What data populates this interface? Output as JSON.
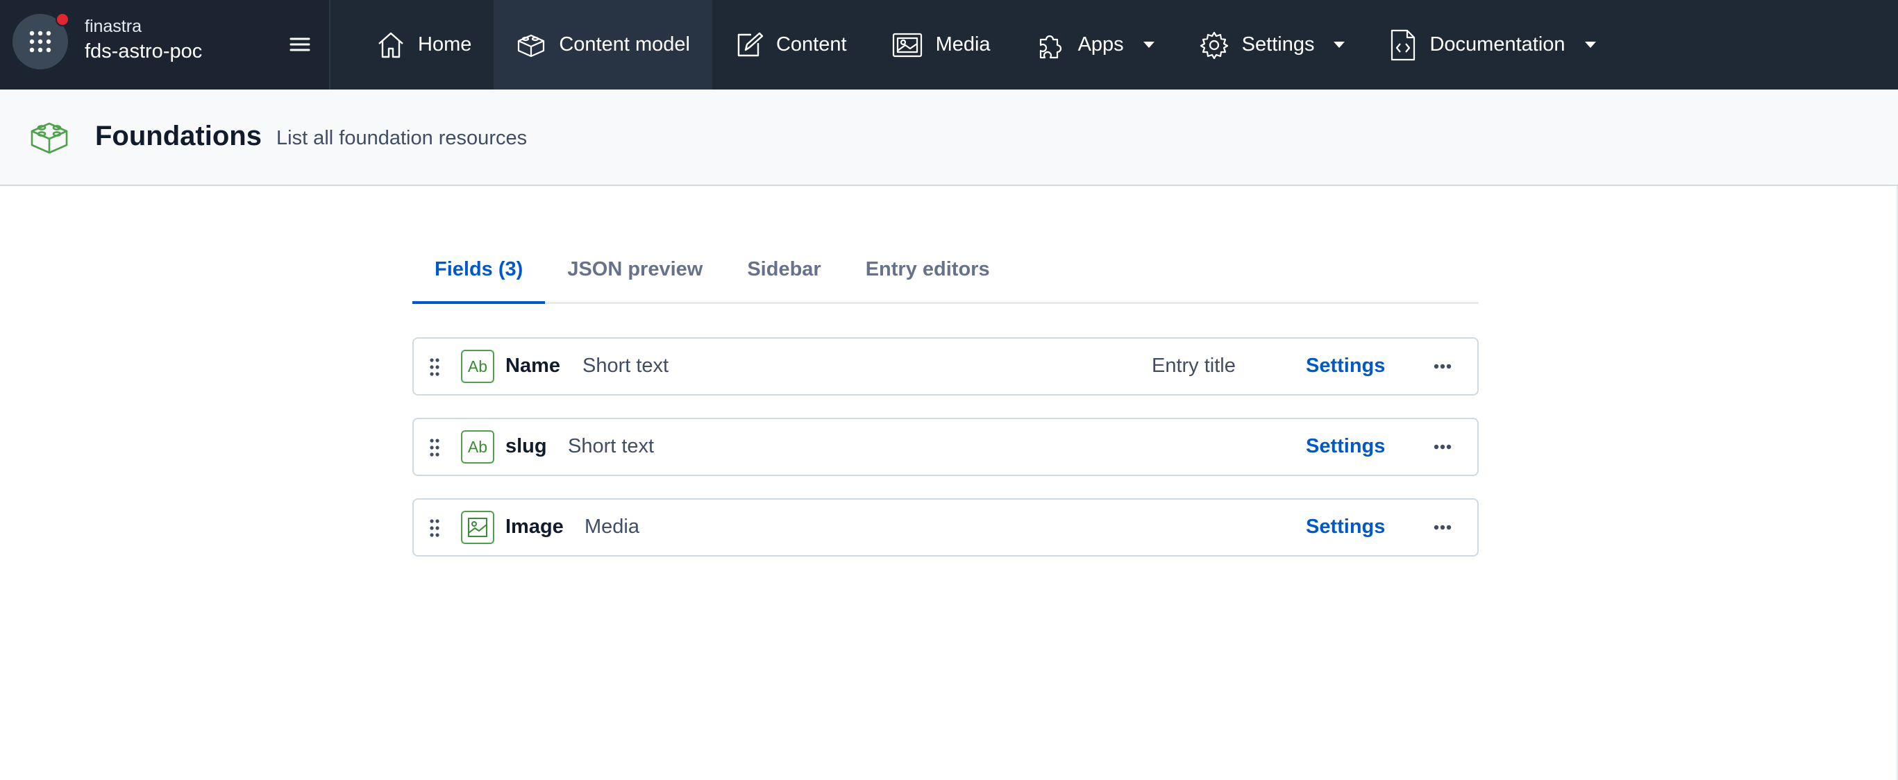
{
  "org": {
    "name": "finastra",
    "space": "fds-astro-poc"
  },
  "nav": [
    {
      "label": "Home",
      "icon": "home-icon"
    },
    {
      "label": "Content model",
      "icon": "content-model-icon",
      "active": true
    },
    {
      "label": "Content",
      "icon": "content-icon"
    },
    {
      "label": "Media",
      "icon": "media-icon"
    },
    {
      "label": "Apps",
      "icon": "apps-icon",
      "dropdown": true
    },
    {
      "label": "Settings",
      "icon": "settings-icon",
      "dropdown": true
    },
    {
      "label": "Documentation",
      "icon": "documentation-icon",
      "dropdown": true
    }
  ],
  "header": {
    "title": "Foundations",
    "description": "List all foundation resources",
    "icon": "content-type-icon"
  },
  "tabs": [
    {
      "label": "Fields (3)",
      "active": true
    },
    {
      "label": "JSON preview"
    },
    {
      "label": "Sidebar"
    },
    {
      "label": "Entry editors"
    }
  ],
  "fields": [
    {
      "name": "Name",
      "type": "Short text",
      "badge": "Entry title",
      "settings": "Settings",
      "icon": "Ab"
    },
    {
      "name": "slug",
      "type": "Short text",
      "badge": "",
      "settings": "Settings",
      "icon": "Ab"
    },
    {
      "name": "Image",
      "type": "Media",
      "badge": "",
      "settings": "Settings",
      "icon": "image-icon"
    }
  ],
  "colors": {
    "nav_bg": "#1b2430",
    "accent": "#0059c8",
    "field_icon": "#4ea24b",
    "notification": "#e0262e"
  }
}
